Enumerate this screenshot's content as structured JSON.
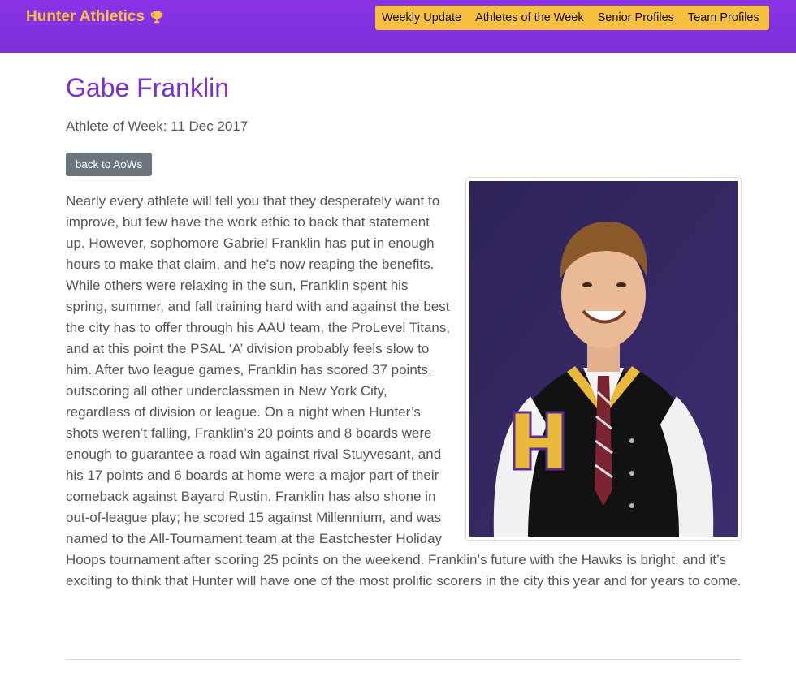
{
  "navbar": {
    "brand": "Hunter Athletics",
    "brand_icon": "trophy-icon",
    "links": [
      "Weekly Update",
      "Athletes of the Week",
      "Senior Profiles",
      "Team Profiles"
    ],
    "colors": {
      "background": "#7c2fd9",
      "accent": "#f8c040"
    }
  },
  "page": {
    "title": "Gabe Franklin",
    "subtitle": "Athlete of Week: 11 Dec 2017",
    "back_button": "back to AoWs",
    "photo_alt": "Gabe Franklin",
    "body": "Nearly every athlete will tell you that they desperately want to improve, but few have the work ethic to back that statement up. However, sophomore Gabriel Franklin has put in enough hours to make that claim, and he’s now reaping the benefits. While others were relaxing in the sun, Franklin spent his spring, summer, and fall training hard with and against the best the city has to offer through his AAU team, the ProLevel Titans, and at this point the PSAL ‘A’ division probably feels slow to him. After two league games, Franklin has scored 37 points, outscoring all other underclassmen in New York City, regardless of division or league. On a night when Hunter’s shots weren’t falling, Franklin’s 20 points and 8 boards were enough to guarantee a road win against rival Stuyvesant, and his 17 points and 6 boards at home were a major part of their comeback against Bayard Rustin. Franklin has also shone in out-of-league play; he scored 15 against Millennium, and was named to the All-Tournament team at the Eastchester Holiday Hoops tournament after scoring 25 points on the weekend. Franklin’s future with the Hawks is bright, and it’s exciting to think that Hunter will have one of the most prolific scorers in the city this year and for years to come."
  }
}
